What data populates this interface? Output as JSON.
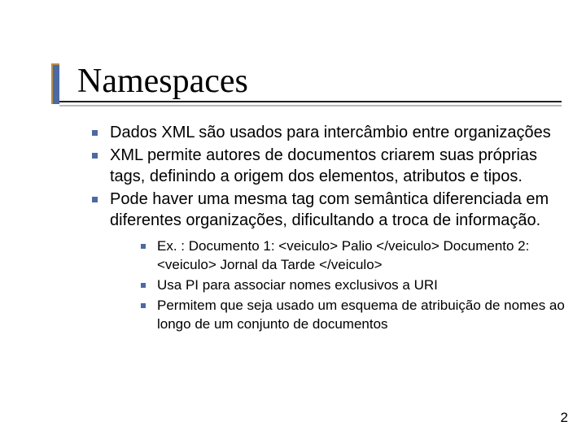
{
  "title": "Namespaces",
  "bullets": [
    "Dados XML são usados para intercâmbio entre organizações",
    "XML permite autores de documentos criarem suas próprias tags, definindo a origem dos elementos, atributos e tipos.",
    " Pode haver uma mesma tag com semântica diferenciada em diferentes organizações, dificultando a troca de informação."
  ],
  "subbullets": [
    "Ex. : Documento 1: <veiculo> Palio </veiculo> Documento 2: <veiculo> Jornal da Tarde </veiculo>",
    "Usa PI para associar nomes exclusivos a URI",
    "Permitem que seja usado um esquema de atribuição de nomes ao longo de um conjunto de documentos"
  ],
  "page": "2"
}
